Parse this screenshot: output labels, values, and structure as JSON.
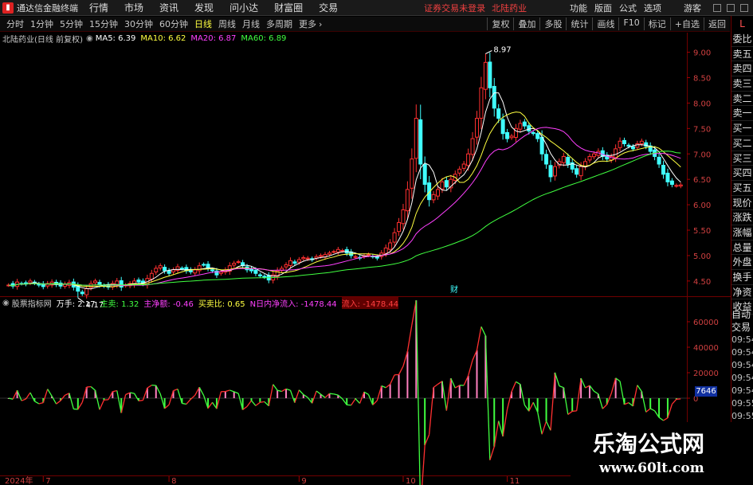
{
  "menubar": {
    "app_title": "通达信金融终端",
    "menus": [
      "行情",
      "市场",
      "资讯",
      "发现",
      "问小达",
      "财富圈",
      "交易"
    ],
    "notice": "证券交易未登录",
    "stock_notice": "北陆药业",
    "right_menus": [
      "功能",
      "版面",
      "公式",
      "选项"
    ],
    "guest": "游客"
  },
  "toolbar": {
    "periods": [
      "分时",
      "1分钟",
      "5分钟",
      "15分钟",
      "30分钟",
      "60分钟",
      "日线",
      "周线",
      "月线",
      "多周期",
      "更多"
    ],
    "active_period": "日线",
    "tools": [
      "复权",
      "叠加",
      "多股",
      "统计",
      "画线",
      "F10",
      "标记",
      "+自选",
      "返回"
    ],
    "corner_label": "L"
  },
  "infoline": {
    "stock": "北陆药业(日线 前复权)",
    "ma": [
      {
        "label": "MA5: 6.39",
        "color": "#ffffff"
      },
      {
        "label": "MA10: 6.62",
        "color": "#ffff40"
      },
      {
        "label": "MA20: 6.87",
        "color": "#ff40ff"
      },
      {
        "label": "MA60: 6.89",
        "color": "#40ff40"
      }
    ]
  },
  "indicator": {
    "name": "股票指标网",
    "items": [
      {
        "label": "万手: 2.17",
        "color": "#ffffff"
      },
      {
        "label": "主卖: 1.32",
        "color": "#40ff40"
      },
      {
        "label": "主净额: -0.46",
        "color": "#ff40ff"
      },
      {
        "label": "买卖比: 0.65",
        "color": "#ffff40"
      },
      {
        "label": "N日内净流入: -1478.44",
        "color": "#ff40ff"
      },
      {
        "label": "流入: -1478.44",
        "color": "#ff4040",
        "bg": "#600000"
      }
    ]
  },
  "right_list": [
    "委比",
    "卖五",
    "卖四",
    "卖三",
    "卖二",
    "卖一",
    "买一",
    "买二",
    "买三",
    "买四",
    "买五",
    "现价",
    "涨跌",
    "涨幅",
    "总量",
    "外盘",
    "换手",
    "净资",
    "收益"
  ],
  "right_list2": {
    "head": [
      "自动",
      "交易"
    ],
    "times": [
      "09:54",
      "09:54",
      "09:54",
      "09:54",
      "09:54",
      "09:55",
      "09:55"
    ]
  },
  "box_value": "7646",
  "fin_marker": "财",
  "watermark": {
    "name": "乐淘公式网",
    "url": "www.60lt.com"
  },
  "colors": {
    "up": "#ff3030",
    "down": "#40ffff",
    "ma5": "#ffffff",
    "ma10": "#ffff40",
    "ma20": "#ff40ff",
    "ma60": "#40ff40"
  },
  "chart_data": [
    {
      "type": "candlestick",
      "title": "北陆药业(日线 前复权)",
      "yticks": [
        9.0,
        8.5,
        8.0,
        7.5,
        7.0,
        6.5,
        6.0,
        5.5,
        5.0,
        4.5
      ],
      "ylim": [
        4.2,
        9.15
      ],
      "xticks": [
        {
          "label": "2024年",
          "index": 0
        },
        {
          "label": "7",
          "index": 8
        },
        {
          "label": "8",
          "index": 37
        },
        {
          "label": "9",
          "index": 67
        },
        {
          "label": "10",
          "index": 91
        },
        {
          "label": "11",
          "index": 115
        }
      ],
      "annotations": [
        {
          "label": "8.97",
          "index": 110,
          "value": 8.97
        },
        {
          "label": "4.17",
          "index": 16,
          "value": 4.17
        }
      ],
      "closes": [
        4.42,
        4.4,
        4.48,
        4.45,
        4.44,
        4.5,
        4.46,
        4.42,
        4.39,
        4.45,
        4.48,
        4.43,
        4.4,
        4.44,
        4.47,
        4.38,
        4.3,
        4.25,
        4.35,
        4.45,
        4.5,
        4.42,
        4.4,
        4.38,
        4.45,
        4.5,
        4.38,
        4.42,
        4.45,
        4.5,
        4.48,
        4.45,
        4.55,
        4.65,
        4.75,
        4.8,
        4.7,
        4.65,
        4.72,
        4.78,
        4.75,
        4.7,
        4.68,
        4.72,
        4.8,
        4.82,
        4.75,
        4.7,
        4.62,
        4.68,
        4.72,
        4.8,
        4.85,
        4.88,
        4.8,
        4.72,
        4.7,
        4.65,
        4.6,
        4.58,
        4.52,
        4.62,
        4.7,
        4.75,
        4.82,
        4.9,
        4.85,
        4.92,
        4.96,
        4.95,
        4.92,
        4.98,
        5.0,
        5.02,
        5.05,
        5.08,
        5.12,
        5.1,
        5.05,
        5.0,
        4.98,
        4.95,
        5.0,
        5.02,
        4.98,
        4.95,
        5.05,
        5.15,
        5.25,
        5.45,
        5.65,
        5.9,
        6.3,
        6.9,
        7.7,
        6.8,
        6.4,
        6.1,
        6.2,
        6.3,
        6.45,
        6.35,
        6.5,
        6.6,
        6.7,
        6.8,
        7.0,
        7.3,
        7.7,
        8.3,
        8.8,
        8.3,
        7.9,
        7.7,
        7.4,
        7.3,
        7.35,
        7.5,
        7.6,
        7.55,
        7.45,
        7.4,
        7.3,
        7.0,
        6.8,
        6.55,
        6.75,
        6.85,
        6.95,
        6.8,
        6.7,
        6.6,
        6.75,
        6.85,
        6.95,
        7.0,
        7.05,
        6.95,
        6.9,
        6.95,
        7.1,
        7.25,
        7.2,
        7.15,
        7.1,
        7.2,
        7.25,
        7.15,
        7.05,
        6.95,
        6.8,
        6.6,
        6.45,
        6.4,
        6.38,
        6.39
      ],
      "series": [
        {
          "name": "MA5",
          "values_note": "computed",
          "window": 5
        },
        {
          "name": "MA10",
          "window": 10
        },
        {
          "name": "MA20",
          "window": 20
        },
        {
          "name": "MA60",
          "window": 60
        }
      ]
    },
    {
      "type": "histogram_line",
      "title": "股票指标网",
      "yticks": [
        60000,
        40000,
        20000,
        0
      ],
      "ylim": [
        -60000,
        70000
      ]
    }
  ]
}
